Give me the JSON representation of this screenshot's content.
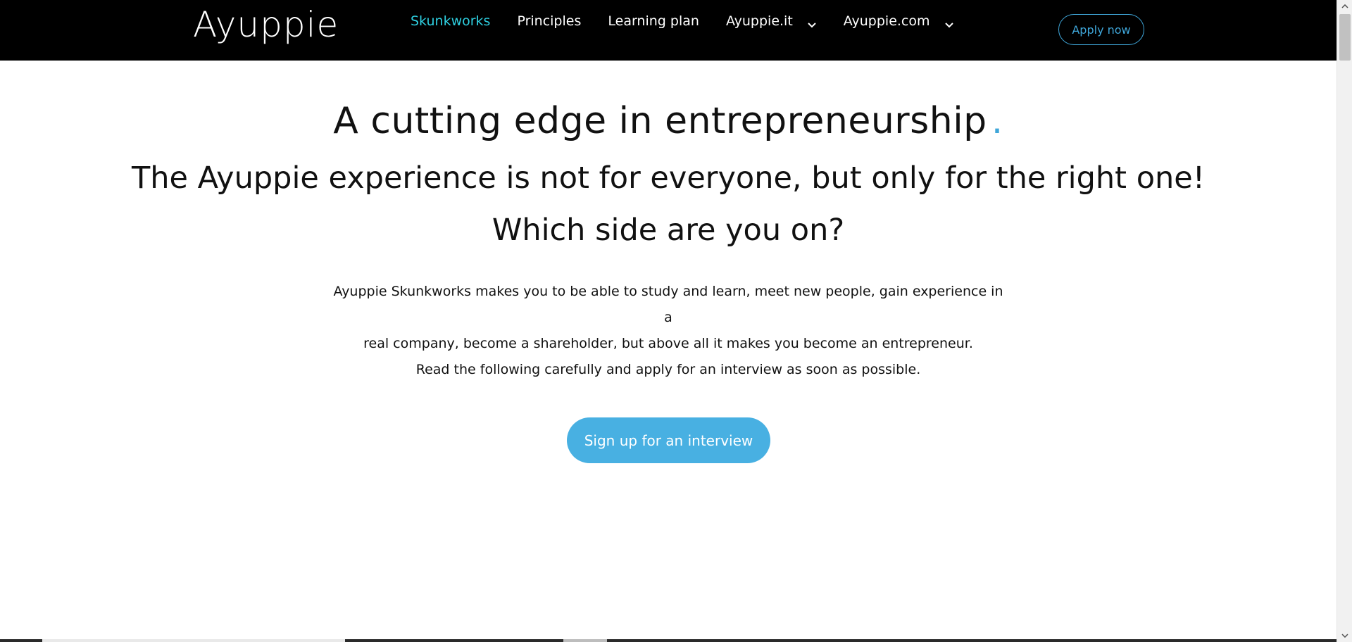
{
  "header": {
    "logo": "Ayuppie",
    "nav": [
      {
        "label": "Skunkworks",
        "active": true,
        "has_dropdown": false
      },
      {
        "label": "Principles",
        "active": false,
        "has_dropdown": false
      },
      {
        "label": "Learning plan",
        "active": false,
        "has_dropdown": false
      },
      {
        "label": "Ayuppie.it",
        "active": false,
        "has_dropdown": true
      },
      {
        "label": "Ayuppie.com",
        "active": false,
        "has_dropdown": true
      }
    ],
    "apply_label": "Apply now"
  },
  "hero": {
    "headline": "A cutting edge in entrepreneurship",
    "headline_dot": ".",
    "subhead": "The Ayuppie experience is not for everyone, but only for the right one!",
    "question": "Which side are you on?",
    "body_lines": [
      "Ayuppie Skunkworks makes you to be able to study and learn, meet new people, gain experience in a",
      "real company, become a shareholder, but above all it makes you become an entrepreneur.",
      "Read the following carefully and apply for an interview as soon as possible."
    ],
    "cta_label": "Sign up for an interview"
  },
  "colors": {
    "header_bg": "#000000",
    "accent_cyan": "#2ecfe0",
    "accent_blue": "#48b0e2",
    "text": "#111111"
  },
  "icons": {
    "dropdown": "chevron-down-icon",
    "scroll_up": "scroll-up-arrow-icon",
    "scroll_down": "scroll-down-arrow-icon"
  }
}
